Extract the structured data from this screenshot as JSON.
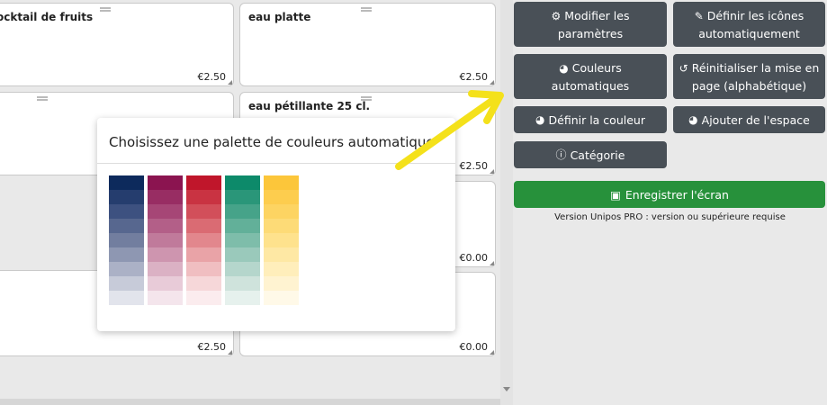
{
  "tiles": [
    {
      "name": "ocktail de fruits",
      "price": "€2.50"
    },
    {
      "name": "eau platte",
      "price": "€2.50"
    },
    {
      "name": "",
      "price": ""
    },
    {
      "name": "eau pétillante 25 cl.",
      "price": "€2.50"
    },
    {
      "name": "",
      "price": "€0.00"
    },
    {
      "name": "",
      "price": "€2.50"
    },
    {
      "name": "",
      "price": "€0.00"
    }
  ],
  "panel": {
    "modify_settings": "Modifier les paramètres",
    "auto_icons": "Définir les icônes automatiquement",
    "auto_colors": "Couleurs automatiques",
    "reset_layout": "Réinitialiser la mise en page (alphabétique)",
    "set_color": "Définir la couleur",
    "add_space": "Ajouter de l'espace",
    "category": "Catégorie",
    "save": "Enregistrer l'écran",
    "version_note": "Version Unipos PRO : version ou supérieure requise"
  },
  "modal": {
    "title": "Choisissez une palette de couleurs automatique",
    "palettes": [
      {
        "name": "navy",
        "colors": [
          "#0d2a5c",
          "#253d6e",
          "#3d5180",
          "#57678f",
          "#727e9f",
          "#8e97b2",
          "#abb1c6",
          "#c7cbd9",
          "#e2e4ec"
        ]
      },
      {
        "name": "magenta",
        "colors": [
          "#8b1450",
          "#982d63",
          "#a64676",
          "#b35f88",
          "#c07a9b",
          "#ce95af",
          "#dbb1c4",
          "#e8cbd8",
          "#f4e5ec"
        ]
      },
      {
        "name": "crimson",
        "colors": [
          "#c0162b",
          "#c93342",
          "#d24f5a",
          "#da6b73",
          "#e2878d",
          "#e9a3a7",
          "#f0bec1",
          "#f6d7d9",
          "#fbecee"
        ]
      },
      {
        "name": "teal",
        "colors": [
          "#0d8a6a",
          "#2a9679",
          "#46a389",
          "#62b099",
          "#7ebdaa",
          "#9ac9bb",
          "#b5d6cc",
          "#cfe3dc",
          "#e6f1ed"
        ]
      },
      {
        "name": "yellow",
        "colors": [
          "#fcc63a",
          "#fdcd4e",
          "#fdd462",
          "#fddb77",
          "#fee28d",
          "#fee8a4",
          "#ffeebb",
          "#fff3d1",
          "#fff9e8"
        ]
      }
    ]
  }
}
